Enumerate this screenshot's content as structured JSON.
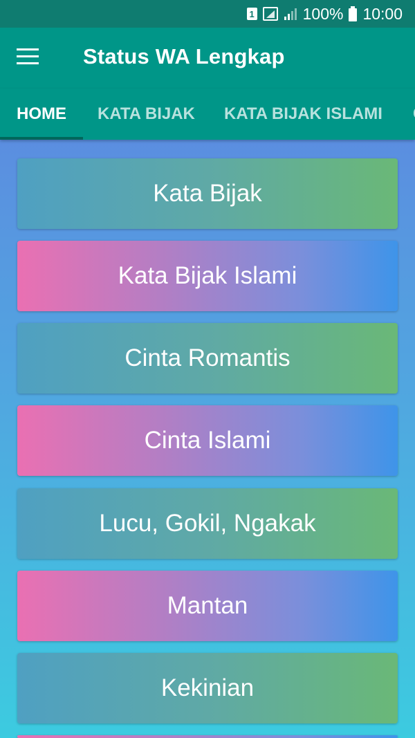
{
  "status_bar": {
    "sim_label": "1",
    "battery_percent": "100%",
    "time": "10:00",
    "icons": [
      "sim-icon",
      "signal-icon",
      "signal-strength-icon",
      "battery-icon"
    ]
  },
  "app_bar": {
    "title": "Status WA Lengkap",
    "menu_icon": "hamburger-menu-icon"
  },
  "tabs": [
    {
      "label": "HOME",
      "active": true
    },
    {
      "label": "KATA BIJAK",
      "active": false
    },
    {
      "label": "KATA BIJAK ISLAMI",
      "active": false
    },
    {
      "label": "C",
      "active": false
    }
  ],
  "categories": [
    {
      "label": "Kata Bijak"
    },
    {
      "label": "Kata Bijak Islami"
    },
    {
      "label": "Cinta Romantis"
    },
    {
      "label": "Cinta Islami"
    },
    {
      "label": "Lucu, Gokil, Ngakak"
    },
    {
      "label": "Mantan"
    },
    {
      "label": "Kekinian"
    },
    {
      "label": ""
    }
  ],
  "colors": {
    "status_bar": "#0f7c70",
    "app_bar": "#009688",
    "tab_indicator": "#00675b",
    "gradient_green": "#6ab877",
    "gradient_pink": "#ea70b2",
    "gradient_blue": "#3e94e9"
  }
}
